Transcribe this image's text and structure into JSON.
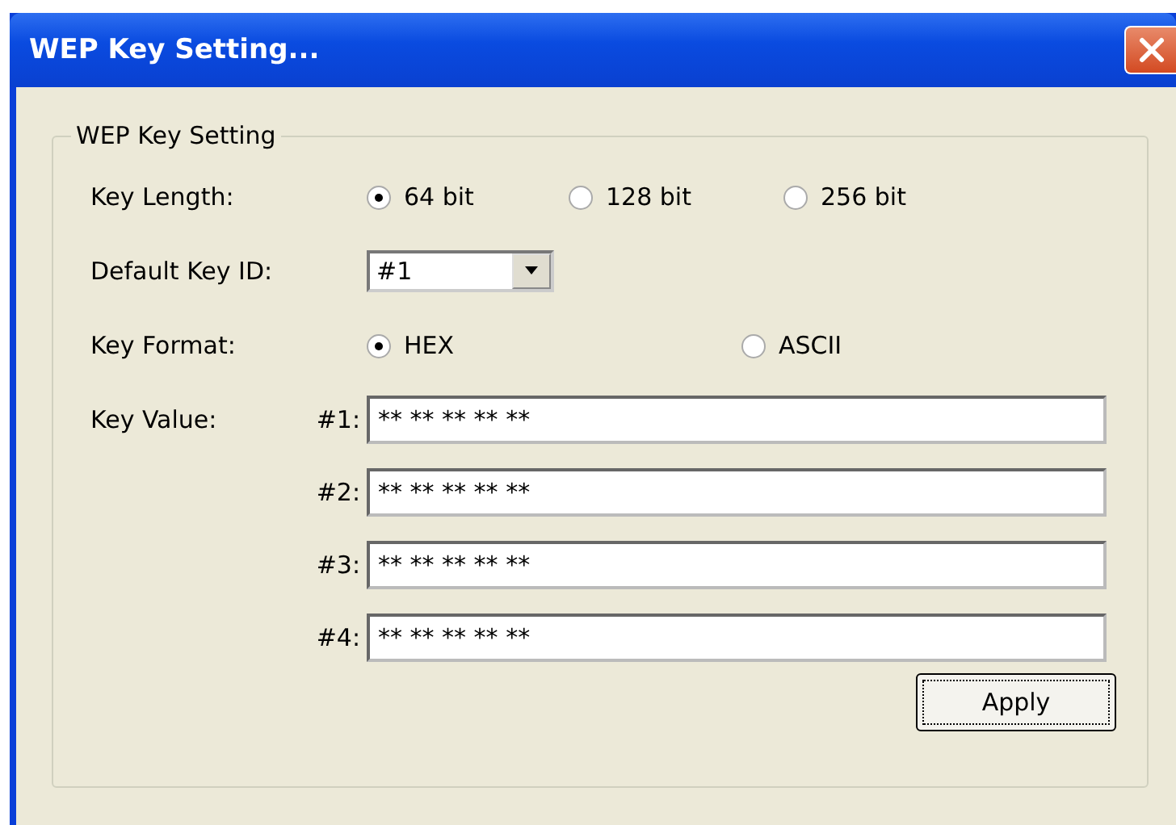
{
  "window": {
    "title": "WEP Key Setting..."
  },
  "group": {
    "legend": "WEP Key Setting"
  },
  "key_length": {
    "label": "Key Length:",
    "options": [
      {
        "label": "64 bit",
        "selected": true
      },
      {
        "label": "128 bit",
        "selected": false
      },
      {
        "label": "256 bit",
        "selected": false
      }
    ]
  },
  "default_key_id": {
    "label": "Default Key ID:",
    "value": "#1"
  },
  "key_format": {
    "label": "Key Format:",
    "options": [
      {
        "label": "HEX",
        "selected": true
      },
      {
        "label": "ASCII",
        "selected": false
      }
    ]
  },
  "key_value": {
    "label": "Key Value:",
    "keys": [
      {
        "label": "#1:",
        "value": "** ** ** ** **"
      },
      {
        "label": "#2:",
        "value": "** ** ** ** **"
      },
      {
        "label": "#3:",
        "value": "** ** ** ** **"
      },
      {
        "label": "#4:",
        "value": "** ** ** ** **"
      }
    ]
  },
  "buttons": [
    "Apply"
  ]
}
